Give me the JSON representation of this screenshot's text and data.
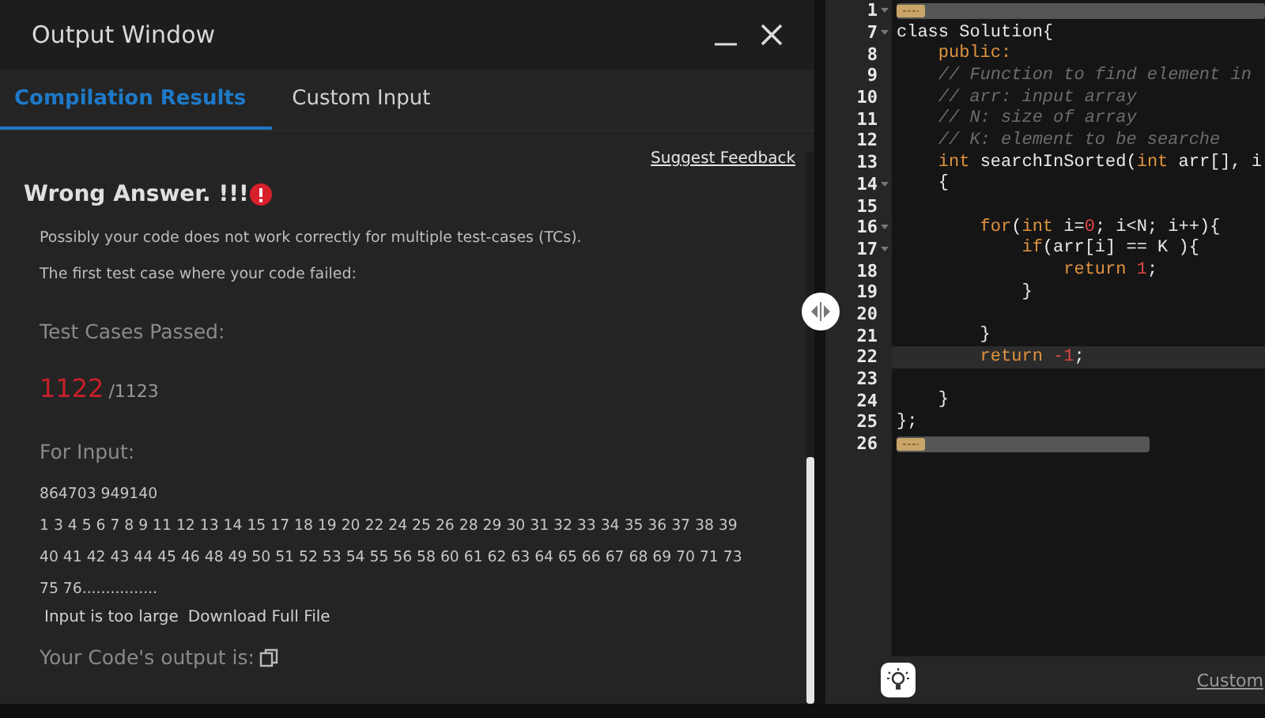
{
  "output_window": {
    "title": "Output Window",
    "tabs": [
      {
        "label": "Compilation Results",
        "selected": true
      },
      {
        "label": "Custom Input",
        "selected": false
      }
    ],
    "suggest_feedback": "Suggest Feedback",
    "verdict": "Wrong Answer. !!!",
    "messages": [
      "Possibly your code does not work correctly for multiple test-cases (TCs).",
      "The first test case where your code failed:"
    ],
    "passed_label": "Test Cases Passed:",
    "passed": "1122",
    "total": "/1123",
    "input_label": "For Input:",
    "input_lines": [
      "864703 949140",
      "1 3 4 5 6 7 8 9 11 12 13 14 15 17 18 19 20 22 24 25 26 28 29 30 31 32 33 34 35 36 37 38 39",
      "40 41 42 43 44 45 46 48 49 50 51 52 53 54 55 56 58 60 61 62 63 64 65 66 67 68 69 70 71 73",
      "75 76................"
    ],
    "too_large": "Input is too large",
    "download": "Download Full File",
    "output_label": "Your Code's output is:"
  },
  "editor": {
    "lines": [
      {
        "number": "1",
        "foldable": true,
        "folded": true,
        "active": false
      },
      {
        "number": "7",
        "foldable": true,
        "folded": false,
        "active": false,
        "tokens": [
          {
            "text": "class Solution{",
            "kind": "plain"
          }
        ]
      },
      {
        "number": "8",
        "foldable": false,
        "folded": false,
        "active": false,
        "tokens": [
          {
            "text": "    public:",
            "kind": "keyword"
          }
        ]
      },
      {
        "number": "9",
        "foldable": false,
        "folded": false,
        "active": false,
        "tokens": [
          {
            "text": "    // Function to find element in",
            "kind": "comment"
          }
        ]
      },
      {
        "number": "10",
        "foldable": false,
        "folded": false,
        "active": false,
        "tokens": [
          {
            "text": "    // arr: input array",
            "kind": "comment"
          }
        ]
      },
      {
        "number": "11",
        "foldable": false,
        "folded": false,
        "active": false,
        "tokens": [
          {
            "text": "    // N: size of array",
            "kind": "comment"
          }
        ]
      },
      {
        "number": "12",
        "foldable": false,
        "folded": false,
        "active": false,
        "tokens": [
          {
            "text": "    // K: element to be searche",
            "kind": "comment"
          }
        ]
      },
      {
        "number": "13",
        "foldable": false,
        "folded": false,
        "active": false,
        "tokens": [
          {
            "text": "    int",
            "kind": "keyword"
          },
          {
            "text": " searchInSorted(",
            "kind": "plain"
          },
          {
            "text": "int",
            "kind": "keyword"
          },
          {
            "text": " arr[], i",
            "kind": "plain"
          }
        ]
      },
      {
        "number": "14",
        "foldable": true,
        "folded": false,
        "active": false,
        "tokens": [
          {
            "text": "    {",
            "kind": "plain"
          }
        ]
      },
      {
        "number": "15",
        "foldable": false,
        "folded": false,
        "active": false
      },
      {
        "number": "16",
        "foldable": true,
        "folded": false,
        "active": false,
        "tokens": [
          {
            "text": "        for",
            "kind": "keyword"
          },
          {
            "text": "(",
            "kind": "plain"
          },
          {
            "text": "int",
            "kind": "keyword"
          },
          {
            "text": " i=",
            "kind": "plain"
          },
          {
            "text": "0",
            "kind": "number"
          },
          {
            "text": "; i<N; i++){",
            "kind": "plain"
          }
        ]
      },
      {
        "number": "17",
        "foldable": true,
        "folded": false,
        "active": false,
        "tokens": [
          {
            "text": "            if",
            "kind": "keyword"
          },
          {
            "text": "(arr[i] == K ){",
            "kind": "plain"
          }
        ]
      },
      {
        "number": "18",
        "foldable": false,
        "folded": false,
        "active": false,
        "tokens": [
          {
            "text": "                return ",
            "kind": "keyword"
          },
          {
            "text": "1",
            "kind": "number"
          },
          {
            "text": ";",
            "kind": "plain"
          }
        ]
      },
      {
        "number": "19",
        "foldable": false,
        "folded": false,
        "active": false,
        "tokens": [
          {
            "text": "            }",
            "kind": "plain"
          }
        ]
      },
      {
        "number": "20",
        "foldable": false,
        "folded": false,
        "active": false
      },
      {
        "number": "21",
        "foldable": false,
        "folded": false,
        "active": false,
        "tokens": [
          {
            "text": "        }",
            "kind": "plain"
          }
        ]
      },
      {
        "number": "22",
        "foldable": false,
        "folded": false,
        "active": true,
        "tokens": [
          {
            "text": "        return ",
            "kind": "keyword"
          },
          {
            "text": "-1",
            "kind": "number"
          },
          {
            "text": ";",
            "kind": "plain"
          }
        ]
      },
      {
        "number": "23",
        "foldable": false,
        "folded": false,
        "active": false
      },
      {
        "number": "24",
        "foldable": false,
        "folded": false,
        "active": false,
        "tokens": [
          {
            "text": "    }",
            "kind": "plain"
          }
        ]
      },
      {
        "number": "25",
        "foldable": false,
        "folded": false,
        "active": false,
        "tokens": [
          {
            "text": "};",
            "kind": "plain"
          }
        ]
      },
      {
        "number": "26",
        "foldable": false,
        "folded": true,
        "active": false
      }
    ],
    "footer_link": "Custom"
  }
}
